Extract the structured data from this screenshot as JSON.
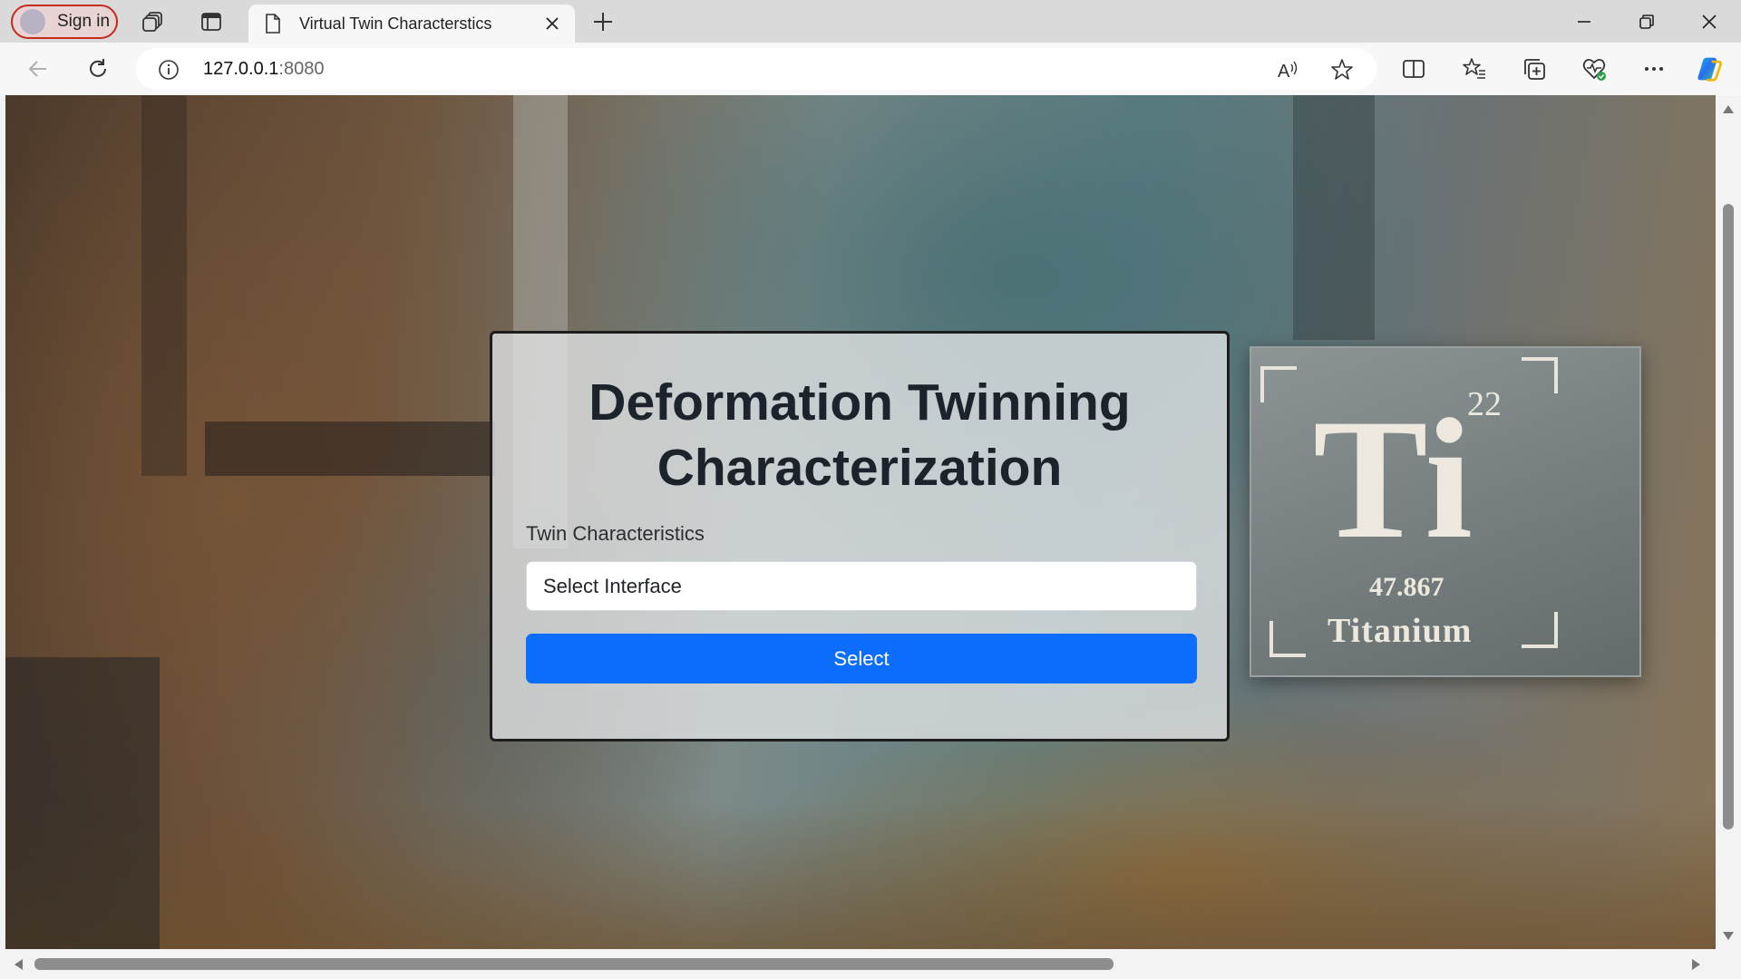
{
  "browser": {
    "signin_label": "Sign in",
    "tab_title": "Virtual Twin Characterstics",
    "url_host": "127.0.0.1",
    "url_port": ":8080",
    "icons": [
      "workspaces-icon",
      "tab-actions-icon",
      "page-icon",
      "close-tab-icon",
      "new-tab-icon",
      "minimize-icon",
      "restore-icon",
      "close-window-icon",
      "back-icon",
      "refresh-icon",
      "site-info-icon",
      "read-aloud-icon",
      "favorite-star-icon",
      "split-screen-icon",
      "favorites-icon",
      "collections-icon",
      "browser-essentials-icon",
      "more-menu-icon",
      "copilot-icon"
    ]
  },
  "background": {
    "element_number": "22",
    "element_symbol": "Ti",
    "element_mass": "47.867",
    "element_name": "Titanium"
  },
  "form": {
    "title": "Deformation Twinning Characterization",
    "field_label": "Twin Characteristics",
    "select_value": "Select Interface",
    "button_label": "Select"
  },
  "colors": {
    "primary_button": "#0d6efd",
    "signin_border": "#c42b1c"
  }
}
